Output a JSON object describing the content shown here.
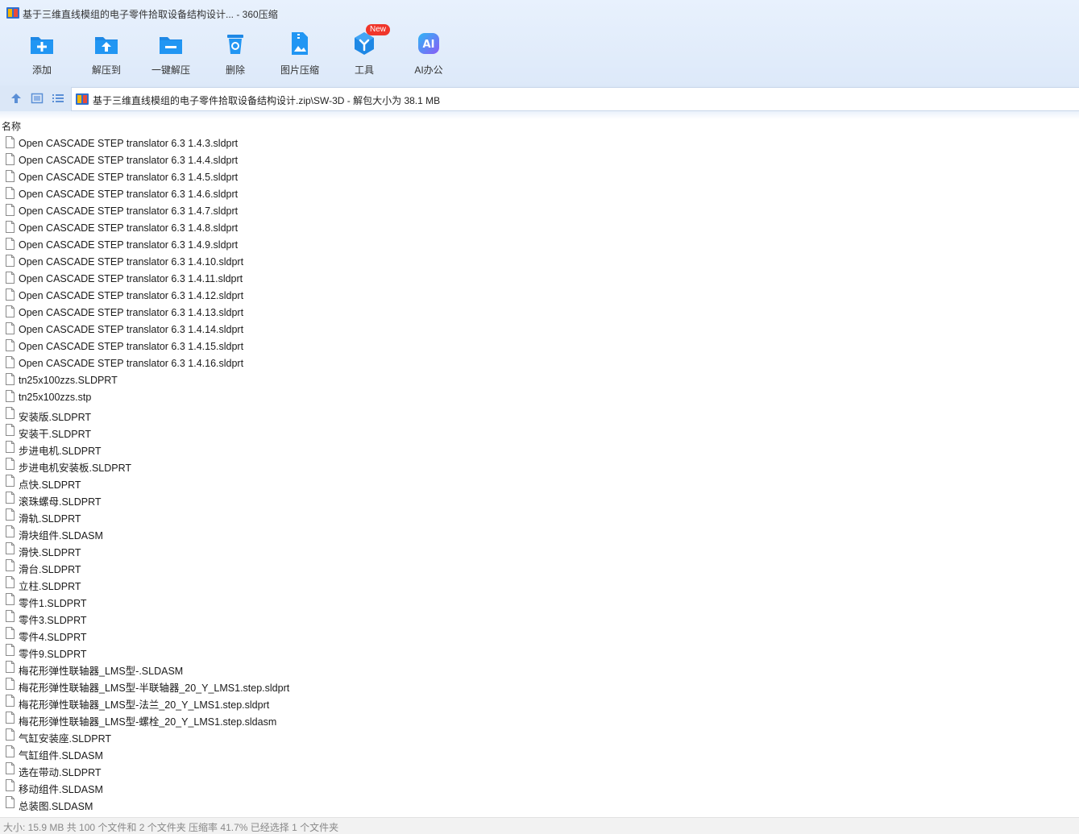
{
  "window": {
    "title": "基于三维直线模组的电子零件拾取设备结构设计... - 360压缩"
  },
  "toolbar": {
    "items": [
      {
        "label": "添加",
        "icon": "add-icon"
      },
      {
        "label": "解压到",
        "icon": "extract-to-icon"
      },
      {
        "label": "一键解压",
        "icon": "one-click-extract-icon"
      },
      {
        "label": "删除",
        "icon": "delete-icon"
      },
      {
        "label": "图片压缩",
        "icon": "image-compress-icon"
      },
      {
        "label": "工具",
        "icon": "tools-icon",
        "badge": "New"
      },
      {
        "label": "AI办公",
        "icon": "ai-office-icon"
      }
    ]
  },
  "address": {
    "path": "基于三维直线模组的电子零件拾取设备结构设计.zip\\SW-3D - 解包大小为 38.1 MB"
  },
  "list": {
    "column_name": "名称",
    "files": [
      "Open CASCADE STEP translator 6.3 1.4.3.sldprt",
      "Open CASCADE STEP translator 6.3 1.4.4.sldprt",
      "Open CASCADE STEP translator 6.3 1.4.5.sldprt",
      "Open CASCADE STEP translator 6.3 1.4.6.sldprt",
      "Open CASCADE STEP translator 6.3 1.4.7.sldprt",
      "Open CASCADE STEP translator 6.3 1.4.8.sldprt",
      "Open CASCADE STEP translator 6.3 1.4.9.sldprt",
      "Open CASCADE STEP translator 6.3 1.4.10.sldprt",
      "Open CASCADE STEP translator 6.3 1.4.11.sldprt",
      "Open CASCADE STEP translator 6.3 1.4.12.sldprt",
      "Open CASCADE STEP translator 6.3 1.4.13.sldprt",
      "Open CASCADE STEP translator 6.3 1.4.14.sldprt",
      "Open CASCADE STEP translator 6.3 1.4.15.sldprt",
      "Open CASCADE STEP translator 6.3 1.4.16.sldprt",
      "tn25x100zzs.SLDPRT",
      "tn25x100zzs.stp",
      "安装版.SLDPRT",
      "安装干.SLDPRT",
      "步进电机.SLDPRT",
      "步进电机安装板.SLDPRT",
      "点快.SLDPRT",
      "滚珠螺母.SLDPRT",
      "滑轨.SLDPRT",
      "滑块组件.SLDASM",
      "滑快.SLDPRT",
      "滑台.SLDPRT",
      "立柱.SLDPRT",
      "零件1.SLDPRT",
      "零件3.SLDPRT",
      "零件4.SLDPRT",
      "零件9.SLDPRT",
      "梅花形弹性联轴器_LMS型-.SLDASM",
      "梅花形弹性联轴器_LMS型-半联轴器_20_Y_LMS1.step.sldprt",
      "梅花形弹性联轴器_LMS型-法兰_20_Y_LMS1.step.sldprt",
      "梅花形弹性联轴器_LMS型-螺栓_20_Y_LMS1.step.sldasm",
      "气缸安装座.SLDPRT",
      "气缸组件.SLDASM",
      "选在带动.SLDPRT",
      "移动组件.SLDASM",
      "总装图.SLDASM"
    ]
  },
  "status": {
    "text": "大小: 15.9 MB 共 100 个文件和 2 个文件夹 压缩率 41.7% 已经选择 1 个文件夹"
  },
  "colors": {
    "toolbar_bg": "#e3edfb",
    "icon_blue": "#1e88e5",
    "badge_red": "#f0362b",
    "ai_gradient_start": "#2fb6f5",
    "ai_gradient_end": "#8a5cf6"
  }
}
